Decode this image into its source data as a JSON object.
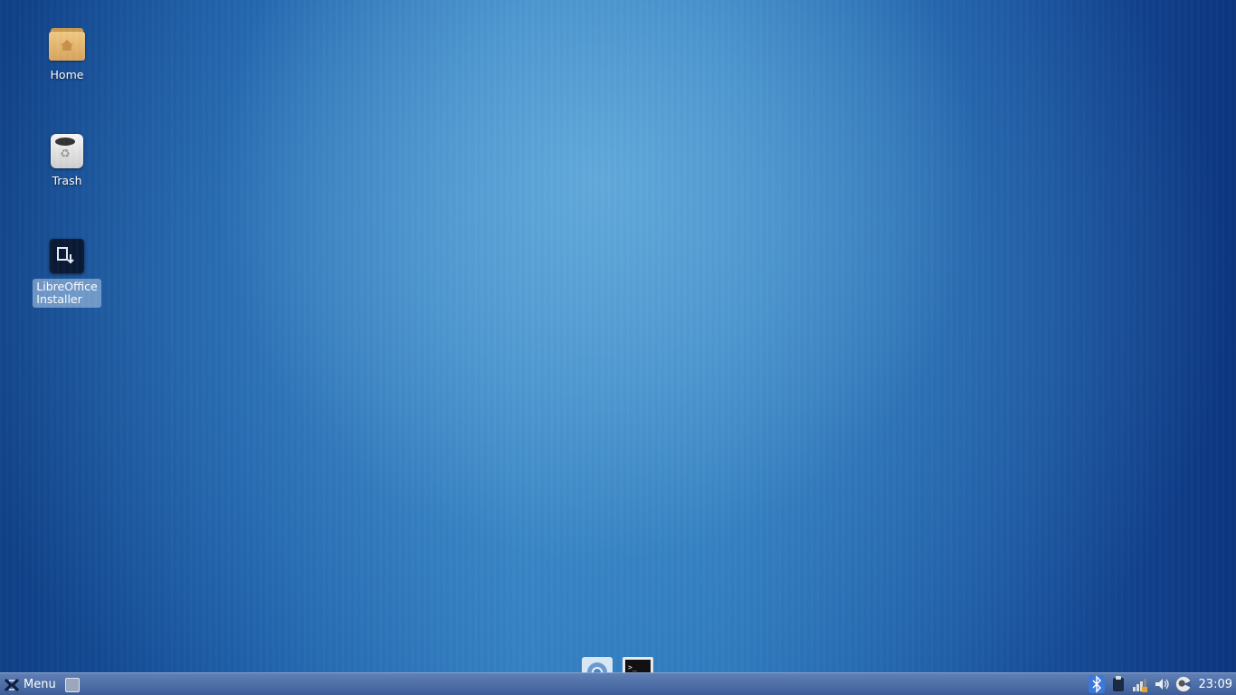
{
  "desktop": {
    "icons": [
      {
        "label": "Home",
        "icon": "home-folder-icon"
      },
      {
        "label": "Trash",
        "icon": "trash-icon"
      },
      {
        "label": "LibreOffice\nInstaller",
        "icon": "installer-icon",
        "selected": true
      }
    ]
  },
  "dock": {
    "items": [
      {
        "name": "chromium-browser",
        "icon": "chromium-icon"
      },
      {
        "name": "terminal",
        "icon": "terminal-icon",
        "prompt": ">_"
      }
    ]
  },
  "panel": {
    "menu_label": "Menu",
    "tray": [
      "bluetooth-icon",
      "clipboard-icon",
      "network-icon",
      "volume-icon",
      "user-status-icon"
    ],
    "clock": "23:09"
  },
  "colors": {
    "panel": "#4f6fa8",
    "desktop_center": "#5aa5d8",
    "desktop_edge": "#0c3580",
    "selection": "#8cafd7"
  }
}
